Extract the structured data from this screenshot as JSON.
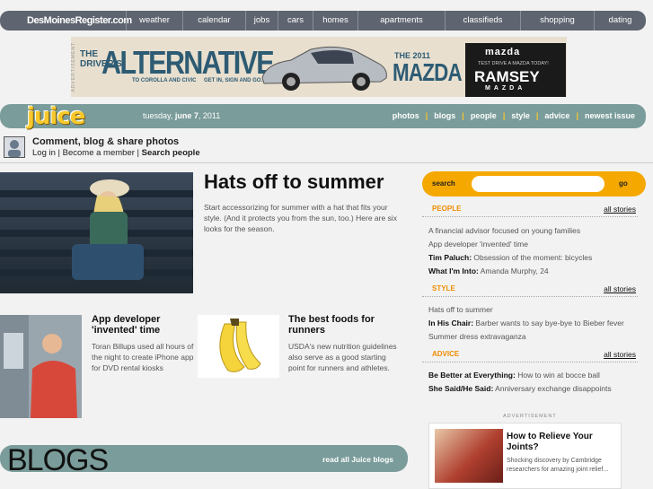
{
  "topnav": {
    "logo": "DesMoinesRegister.com",
    "items": [
      "weather",
      "calendar",
      "jobs",
      "cars",
      "homes",
      "apartments",
      "classifieds",
      "shopping",
      "dating"
    ]
  },
  "ad_banner": {
    "label": "ADVERTISEMENT",
    "drivers": "THE DRIVER'S",
    "headline": "ALTERNATIVE",
    "sub1": "TO COROLLA AND CIVIC",
    "sub2": "GET IN, SIGN AND GO.",
    "model_year": "THE 2011",
    "model": "MAZDA 3",
    "dealer_brand": "mazda",
    "dealer_tagline": "TEST DRIVE A MAZDA TODAY!",
    "dealer_name": "RAMSEY",
    "dealer_sub": "MAZDA"
  },
  "juicebar": {
    "logo": "juice",
    "date_day": "tuesday,",
    "date_bold": "june 7",
    "date_year": ", 2011",
    "nav": [
      "photos",
      "blogs",
      "people",
      "style",
      "advice",
      "newest issue"
    ]
  },
  "member": {
    "title": "Comment, blog & share photos",
    "login": "Log in",
    "sep1": " | ",
    "become": "Become a member",
    "sep2": " | ",
    "search_people": "Search people"
  },
  "main_story": {
    "title": "Hats off to summer",
    "desc": "Start accessorizing for summer with a hat that fits your style. (And it protects you from the sun, too.) Here are six looks for the season."
  },
  "story2": {
    "title": "App developer 'invented' time",
    "desc": "Toran Billups used all hours of the night to create iPhone app for DVD rental kiosks"
  },
  "story3": {
    "title": "The best foods for runners",
    "desc": "USDA's new nutrition guidelines also serve as a good starting point for runners and athletes."
  },
  "blogs": {
    "title": "BLOGS",
    "link": "read all Juice blogs"
  },
  "search": {
    "label": "search",
    "placeholder": "",
    "go": "go"
  },
  "people": {
    "head": "PEOPLE",
    "all": "all stories",
    "items": [
      {
        "bold": "",
        "text": "A financial advisor focused on young families"
      },
      {
        "bold": "",
        "text": "App developer 'invented' time"
      },
      {
        "bold": "Tim Paluch:",
        "text": " Obsession of the moment: bicycles"
      },
      {
        "bold": "What I'm Into:",
        "text": " Amanda Murphy, 24"
      }
    ]
  },
  "style": {
    "head": "STYLE",
    "all": "all stories",
    "items": [
      {
        "bold": "",
        "text": "Hats off to summer"
      },
      {
        "bold": "In His Chair:",
        "text": " Barber wants to say bye-bye to Bieber fever"
      },
      {
        "bold": "",
        "text": "Summer dress extravaganza"
      }
    ]
  },
  "advice": {
    "head": "ADVICE",
    "all": "all stories",
    "items": [
      {
        "bold": "Be Better at Everything:",
        "text": " How to win at bocce ball"
      },
      {
        "bold": "She Said/He Said:",
        "text": " Anniversary exchange disappoints"
      }
    ]
  },
  "ad_right": {
    "label": "ADVERTISEMENT",
    "title": "How to Relieve Your Joints?",
    "desc": "Shocking discovery by Cambridge researchers for amazing joint relief..."
  }
}
